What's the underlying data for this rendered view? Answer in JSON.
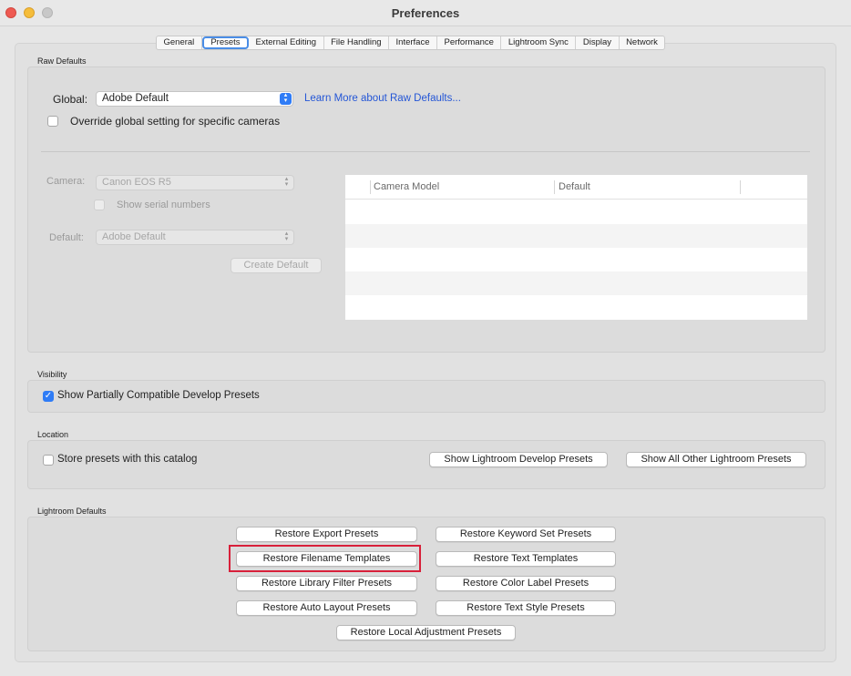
{
  "window": {
    "title": "Preferences"
  },
  "tabs": [
    "General",
    "Presets",
    "External Editing",
    "File Handling",
    "Interface",
    "Performance",
    "Lightroom Sync",
    "Display",
    "Network"
  ],
  "active_tab": "Presets",
  "raw_defaults": {
    "section_label": "Raw Defaults",
    "global_label": "Global:",
    "global_value": "Adobe Default",
    "learn_more_link": "Learn More about Raw Defaults...",
    "override_label": "Override global setting for specific cameras",
    "override_checked": false,
    "camera_label": "Camera:",
    "camera_value": "Canon EOS R5",
    "show_serial_label": "Show serial numbers",
    "default_label": "Default:",
    "default_value": "Adobe Default",
    "create_default_button": "Create Default",
    "table": {
      "columns": [
        "Camera Model",
        "Default"
      ],
      "rows": []
    }
  },
  "visibility": {
    "section_label": "Visibility",
    "show_partial_label": "Show Partially Compatible Develop Presets",
    "show_partial_checked": true
  },
  "location": {
    "section_label": "Location",
    "store_label": "Store presets with this catalog",
    "store_checked": false,
    "show_develop_button": "Show Lightroom Develop Presets",
    "show_all_other_button": "Show All Other Lightroom Presets"
  },
  "lightroom_defaults": {
    "section_label": "Lightroom Defaults",
    "restore_export": "Restore Export Presets",
    "restore_keyword_set": "Restore Keyword Set Presets",
    "restore_filename": "Restore Filename Templates",
    "restore_text_templates": "Restore Text Templates",
    "restore_library_filter": "Restore Library Filter Presets",
    "restore_color_label": "Restore Color Label Presets",
    "restore_auto_layout": "Restore Auto Layout Presets",
    "restore_text_style": "Restore Text Style Presets",
    "restore_local_adjustment": "Restore Local Adjustment Presets"
  },
  "colors": {
    "accent": "#2f7cf6",
    "highlight_border": "#d8203a",
    "link": "#2456d6"
  }
}
